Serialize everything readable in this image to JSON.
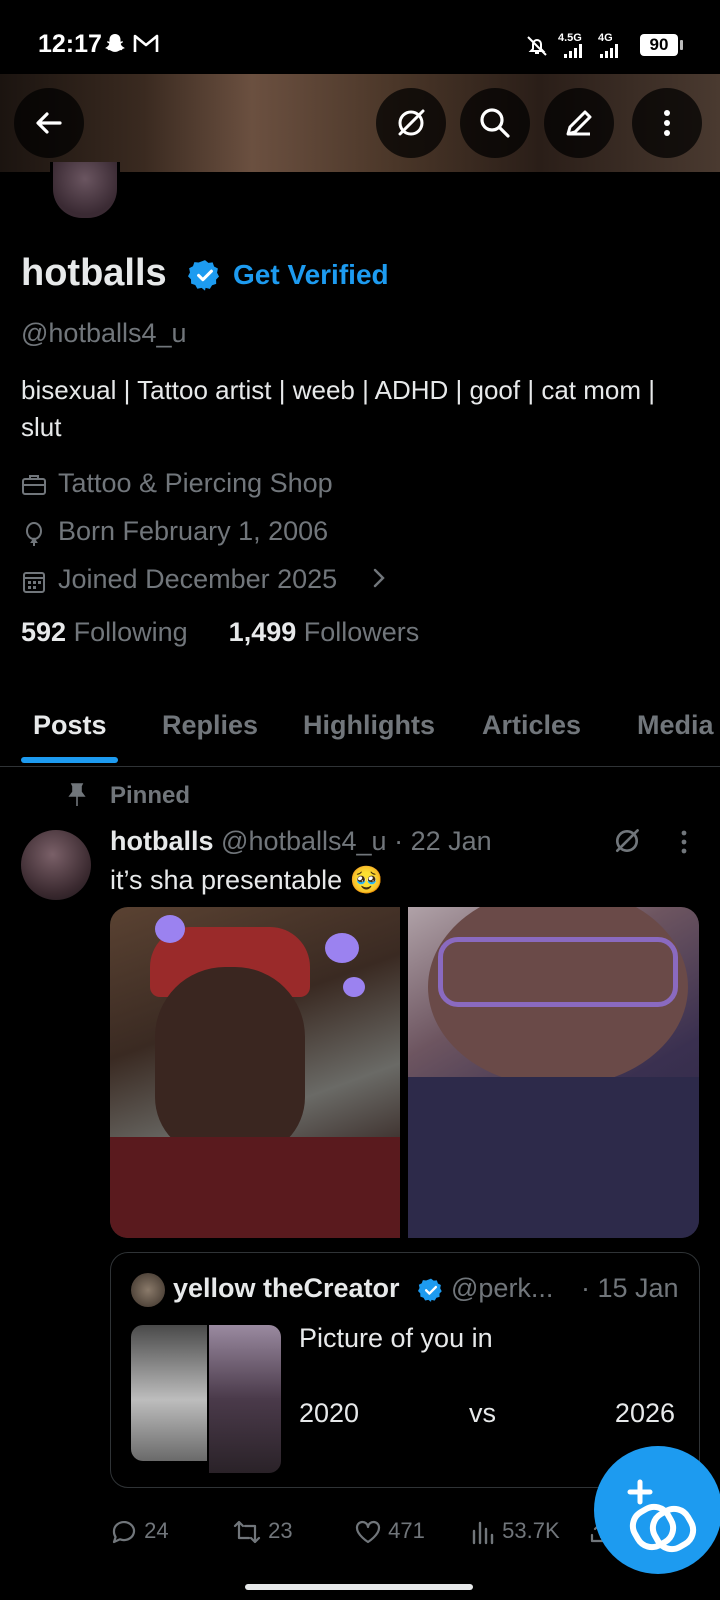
{
  "status_bar": {
    "time": "12:17",
    "network1": "4.5G",
    "network2": "4G",
    "battery": "90",
    "icons": [
      "snapchat-icon",
      "gmail-icon",
      "muted-bell-icon",
      "signal-icon",
      "signal-icon",
      "battery-icon"
    ]
  },
  "header": {
    "icons": [
      "back-arrow-icon",
      "grok-icon",
      "search-icon",
      "compose-icon",
      "more-vertical-icon"
    ]
  },
  "profile": {
    "name": "hotballs",
    "get_verified": "Get Verified",
    "handle": "@hotballs4_u",
    "bio": "bisexual | Tattoo artist | weeb | ADHD | goof | cat mom | slut",
    "category": "Tattoo & Piercing Shop",
    "born": "Born February 1, 2006",
    "joined": "Joined December 2025",
    "following_count": "592",
    "following_label": "Following",
    "followers_count": "1,499",
    "followers_label": "Followers"
  },
  "tabs": [
    "Posts",
    "Replies",
    "Highlights",
    "Articles",
    "Media"
  ],
  "active_tab": "Posts",
  "post": {
    "pinned_label": "Pinned",
    "author": "hotballs",
    "handle": "@hotballs4_u",
    "date": "· 22 Jan",
    "text": "it’s sha presentable 🥹",
    "quote": {
      "author": "yellow theCreator",
      "handle": "@perk...",
      "date": "· 15 Jan",
      "line1": "Picture of you in",
      "year1": "2020",
      "vs": "vs",
      "year2": "2026"
    },
    "actions": {
      "replies": "24",
      "reposts": "23",
      "likes": "471",
      "views": "53.7K"
    }
  },
  "colors": {
    "accent": "#1d9bf0",
    "text": "#e7e9ea",
    "muted": "#71767b",
    "background": "#000000",
    "border": "#2f3336"
  }
}
